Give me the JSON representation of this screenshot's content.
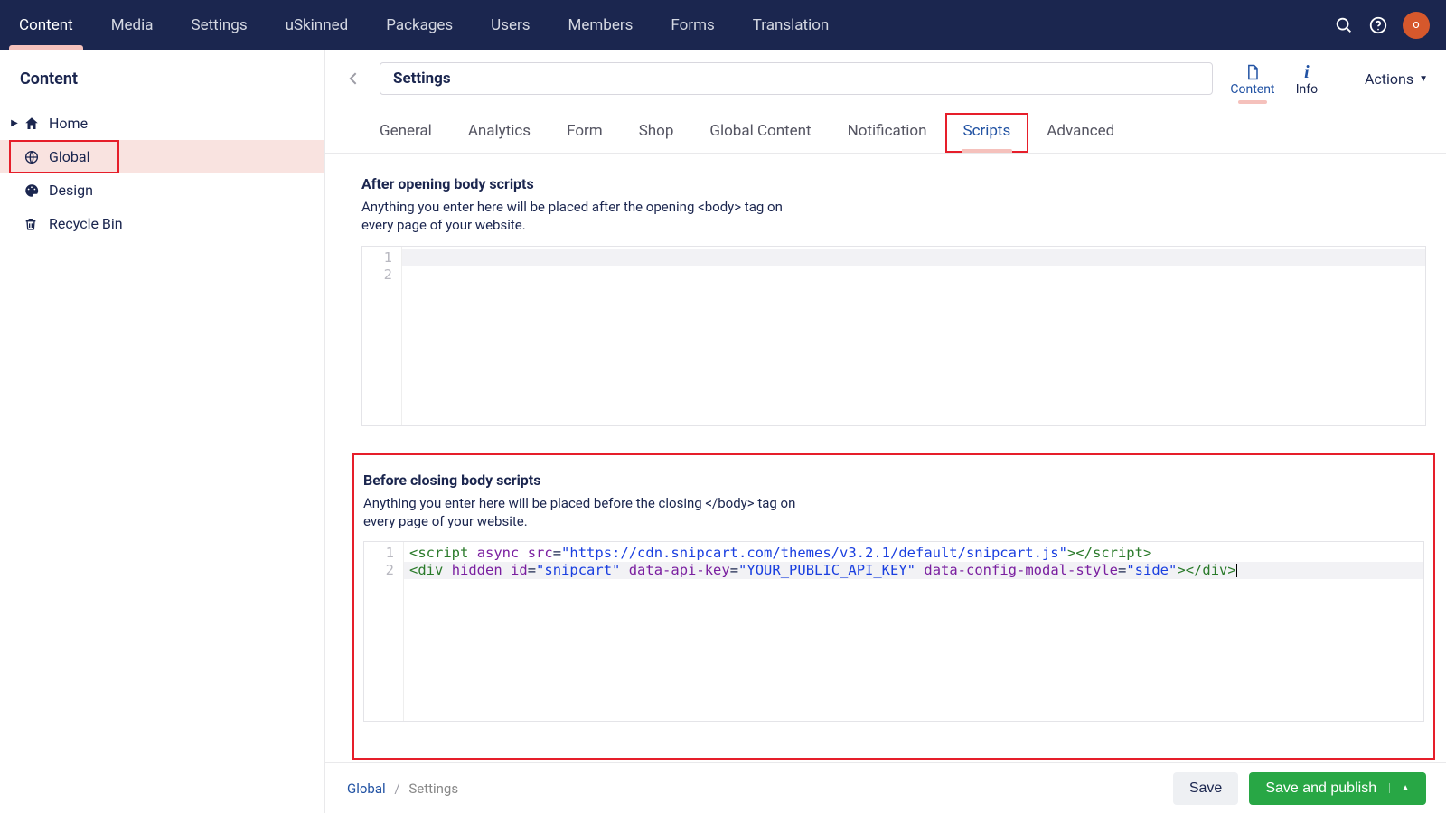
{
  "topnav": {
    "tabs": [
      "Content",
      "Media",
      "Settings",
      "uSkinned",
      "Packages",
      "Users",
      "Members",
      "Forms",
      "Translation"
    ],
    "active": 0,
    "avatar_initial": "o"
  },
  "sidebar": {
    "heading": "Content",
    "nodes": [
      {
        "label": "Home",
        "icon": "home",
        "expandable": true
      },
      {
        "label": "Global",
        "icon": "globe",
        "selected": true
      },
      {
        "label": "Design",
        "icon": "palette"
      },
      {
        "label": "Recycle Bin",
        "icon": "trash"
      }
    ]
  },
  "editor": {
    "title": "Settings",
    "apptabs": [
      {
        "label": "Content",
        "icon": "document",
        "active": true
      },
      {
        "label": "Info",
        "icon": "info"
      }
    ],
    "actions_label": "Actions",
    "content_tabs": [
      "General",
      "Analytics",
      "Form",
      "Shop",
      "Global Content",
      "Notification",
      "Scripts",
      "Advanced"
    ],
    "content_tab_active": 6,
    "sections": {
      "after_open": {
        "title": "After opening body scripts",
        "desc": "Anything you enter here will be placed after the opening <body> tag on every page of your website.",
        "gutter": [
          "1",
          "2"
        ],
        "lines": [
          "",
          ""
        ]
      },
      "before_close": {
        "title": "Before closing body scripts",
        "desc": "Anything you enter here will be placed before the closing </body> tag on every page of your website.",
        "gutter": [
          "1",
          "2"
        ],
        "code_tokens": [
          [
            {
              "t": "<",
              "c": "tok-tag"
            },
            {
              "t": "script",
              "c": "tok-tag"
            },
            {
              "t": " "
            },
            {
              "t": "async",
              "c": "tok-attr"
            },
            {
              "t": " "
            },
            {
              "t": "src",
              "c": "tok-attr"
            },
            {
              "t": "="
            },
            {
              "t": "\"https://cdn.snipcart.com/themes/v3.2.1/default/snipcart.js\"",
              "c": "tok-str"
            },
            {
              "t": ">",
              "c": "tok-tag"
            },
            {
              "t": "</",
              "c": "tok-tag"
            },
            {
              "t": "script",
              "c": "tok-tag"
            },
            {
              "t": ">",
              "c": "tok-tag"
            }
          ],
          [
            {
              "t": "<",
              "c": "tok-tag"
            },
            {
              "t": "div",
              "c": "tok-tag"
            },
            {
              "t": " "
            },
            {
              "t": "hidden",
              "c": "tok-attr"
            },
            {
              "t": " "
            },
            {
              "t": "id",
              "c": "tok-attr"
            },
            {
              "t": "="
            },
            {
              "t": "\"snipcart\"",
              "c": "tok-str"
            },
            {
              "t": " "
            },
            {
              "t": "data-api-key",
              "c": "tok-attr"
            },
            {
              "t": "="
            },
            {
              "t": "\"YOUR_PUBLIC_API_KEY\"",
              "c": "tok-str"
            },
            {
              "t": " "
            },
            {
              "t": "data-config-modal-style",
              "c": "tok-attr"
            },
            {
              "t": "="
            },
            {
              "t": "\"side\"",
              "c": "tok-str"
            },
            {
              "t": ">",
              "c": "tok-tag"
            },
            {
              "t": "</",
              "c": "tok-tag"
            },
            {
              "t": "div",
              "c": "tok-tag"
            },
            {
              "t": ">",
              "c": "tok-tag"
            }
          ]
        ]
      }
    },
    "breadcrumb": {
      "root": "Global",
      "leaf": "Settings"
    },
    "buttons": {
      "save": "Save",
      "publish": "Save and publish"
    }
  }
}
